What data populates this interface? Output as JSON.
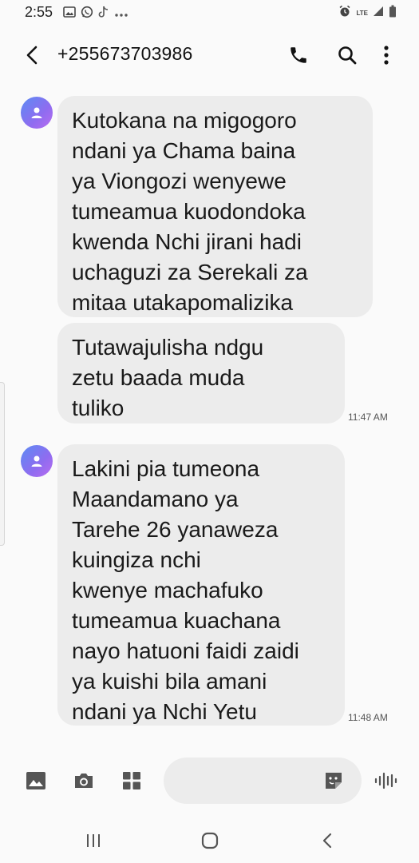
{
  "status_bar": {
    "time": "2:55",
    "network_label": "LTE",
    "icons": [
      "gallery-icon",
      "whatsapp-icon",
      "tiktok-icon",
      "more-dots-icon",
      "alarm-icon",
      "signal-icon",
      "battery-icon"
    ]
  },
  "header": {
    "title": "+255673703986",
    "icons": [
      "back-arrow-icon",
      "phone-icon",
      "search-icon",
      "more-vert-icon"
    ]
  },
  "messages": [
    {
      "text": "Kutokana na migogoro\nndani ya Chama baina\nya Viongozi wenyewe\ntumeamua kuodondoka\nkwenda Nchi jirani hadi\nuchaguzi za Serekali za\nmitaa utakapomalizika",
      "time": ""
    },
    {
      "text": "Tutawajulisha ndgu\nzetu baada muda\ntuliko",
      "time": "11:47 AM"
    },
    {
      "text": "Lakini pia tumeona\nMaandamano ya\nTarehe 26 yanaweza\nkuingiza nchi\nkwenye machafuko\ntumeamua kuachana\nnayo hatuoni faidi zaidi\nya kuishi bila amani\nndani ya Nchi Yetu",
      "time": "11:48 AM"
    }
  ],
  "compose": {
    "placeholder": "",
    "icons": [
      "gallery-icon",
      "camera-icon",
      "apps-grid-icon",
      "sticker-icon",
      "voice-wave-icon"
    ]
  },
  "nav_bar": {
    "icons": [
      "recents-icon",
      "home-icon",
      "back-icon"
    ]
  }
}
